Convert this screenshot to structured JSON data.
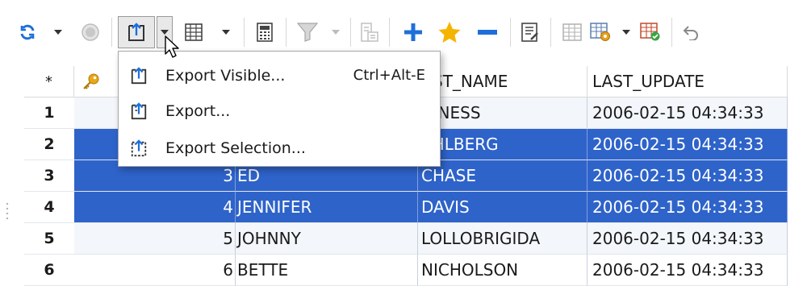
{
  "toolbar": {
    "buttons": [
      {
        "name": "refresh-button",
        "icon": "refresh-icon"
      },
      {
        "name": "refresh-dropdown",
        "icon": "chevron-down-icon"
      },
      {
        "name": "stop-button",
        "icon": "stop-circle-icon"
      },
      {
        "name": "export-button",
        "icon": "export-icon"
      },
      {
        "name": "export-dropdown",
        "icon": "chevron-down-icon"
      },
      {
        "name": "grid-view-button",
        "icon": "grid-icon"
      },
      {
        "name": "grid-view-dropdown",
        "icon": "chevron-down-icon"
      },
      {
        "name": "calculator-button",
        "icon": "calculator-icon"
      },
      {
        "name": "filter-button",
        "icon": "filter-icon"
      },
      {
        "name": "filter-dropdown",
        "icon": "chevron-down-icon"
      },
      {
        "name": "record-view-button",
        "icon": "record-icon"
      },
      {
        "name": "add-row-button",
        "icon": "plus-icon"
      },
      {
        "name": "favorite-button",
        "icon": "star-icon"
      },
      {
        "name": "delete-row-button",
        "icon": "minus-icon"
      },
      {
        "name": "edit-button",
        "icon": "edit-icon"
      },
      {
        "name": "grid-settings-button",
        "icon": "grid-settings-icon"
      },
      {
        "name": "grid-config-button",
        "icon": "grid-config-icon"
      },
      {
        "name": "grid-config-dropdown",
        "icon": "chevron-down-icon"
      },
      {
        "name": "apply-button",
        "icon": "grid-check-icon"
      },
      {
        "name": "undo-button",
        "icon": "undo-icon"
      }
    ]
  },
  "grid": {
    "header": {
      "row_marker": "*",
      "key_icon": "key-icon",
      "first_name_partial": "",
      "last_name": "ST_NAME",
      "last_update": "LAST_UPDATE"
    },
    "rows": [
      {
        "num": "1",
        "id": "",
        "first": "",
        "last": "UINESS",
        "update": "2006-02-15 04:34:33",
        "state": "alt"
      },
      {
        "num": "2",
        "id": "",
        "first": "",
        "last": "AHLBERG",
        "update": "2006-02-15 04:34:33",
        "state": "sel"
      },
      {
        "num": "3",
        "id": "3",
        "first": "ED",
        "last": "CHASE",
        "update": "2006-02-15 04:34:33",
        "state": "sel"
      },
      {
        "num": "4",
        "id": "4",
        "first": "JENNIFER",
        "last": "DAVIS",
        "update": "2006-02-15 04:34:33",
        "state": "sel"
      },
      {
        "num": "5",
        "id": "5",
        "first": "JOHNNY",
        "last": "LOLLOBRIGIDA",
        "update": "2006-02-15 04:34:33",
        "state": "alt"
      },
      {
        "num": "6",
        "id": "6",
        "first": "BETTE",
        "last": "NICHOLSON",
        "update": "2006-02-15 04:34:33",
        "state": "normal"
      }
    ]
  },
  "export_menu": {
    "items": [
      {
        "label": "Export Visible...",
        "shortcut": "Ctrl+Alt-E",
        "icon": "export-visible-icon"
      },
      {
        "label": "Export...",
        "shortcut": "",
        "icon": "export-icon"
      },
      {
        "label": "Export Selection...",
        "shortcut": "",
        "icon": "export-selection-icon"
      }
    ]
  },
  "colors": {
    "selection": "#2e63c9",
    "accent_blue": "#1e6fd9",
    "star": "#f5b400"
  }
}
